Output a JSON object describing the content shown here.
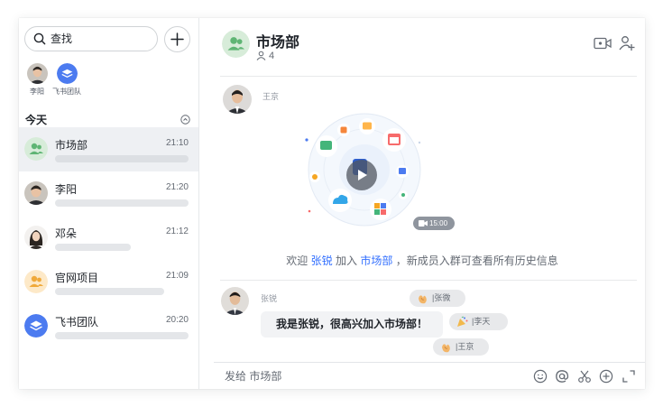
{
  "sidebar": {
    "search_placeholder": "查找",
    "pinned": [
      {
        "label": "李阳"
      },
      {
        "label": "飞书团队"
      }
    ],
    "section_title": "今天",
    "chats": [
      {
        "name": "市场部",
        "time": "21:10",
        "active": true
      },
      {
        "name": "李阳",
        "time": "21:20"
      },
      {
        "name": "邓朵",
        "time": "21:12"
      },
      {
        "name": "官网项目",
        "time": "21:09"
      },
      {
        "name": "飞书团队",
        "time": "20:20"
      }
    ]
  },
  "header": {
    "title": "市场部",
    "member_count": "4"
  },
  "messages": {
    "first_sender": "王京",
    "video_duration": "15:00",
    "system": {
      "prefix": "欢迎",
      "user": "张锐",
      "joined": "加入",
      "group": "市场部",
      "suffix": "，新成员入群可查看所有历史信息"
    },
    "second_sender": "张锐",
    "bubble_text": "我是张锐，很高兴加入市场部！",
    "reactions": [
      {
        "name": "张微",
        "emoji": "clap"
      },
      {
        "name": "李天",
        "emoji": "party-popper"
      },
      {
        "name": "王京",
        "emoji": "clap"
      }
    ]
  },
  "composer": {
    "placeholder": "发给 市场部"
  },
  "colors": {
    "accent_blue": "#3370ff",
    "group_green": "#d7ecd9",
    "group_orange": "#fde9c8",
    "team_blue": "#4c7bf0"
  }
}
